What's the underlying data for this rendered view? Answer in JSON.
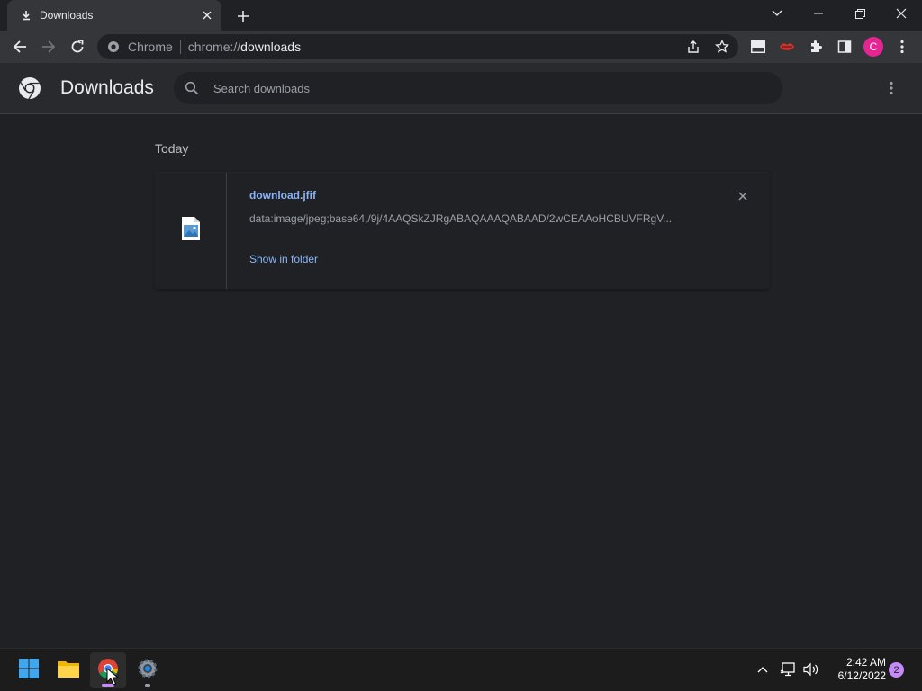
{
  "tab": {
    "title": "Downloads",
    "icon": "download-icon"
  },
  "omnibox": {
    "chip": "Chrome",
    "url_scheme": "chrome://",
    "url_host": "downloads"
  },
  "profile": {
    "initial": "C",
    "color": "#e52592"
  },
  "page": {
    "title": "Downloads",
    "search_placeholder": "Search downloads",
    "section": "Today"
  },
  "downloads": [
    {
      "file_name": "download.jfif",
      "url": "data:image/jpeg;base64,/9j/4AAQSkZJRgABAQAAAQABAAD/2wCEAAoHCBUVFRgV...",
      "action": "Show in folder"
    }
  ],
  "taskbar": {
    "apps": [
      "start-icon",
      "file-explorer-icon",
      "chrome-icon",
      "settings-icon"
    ],
    "time": "2:42 AM",
    "date": "6/12/2022",
    "notifications": "2"
  },
  "colors": {
    "accent": "#8ab4f8",
    "background": "#202124",
    "toolbar": "#35363a"
  }
}
